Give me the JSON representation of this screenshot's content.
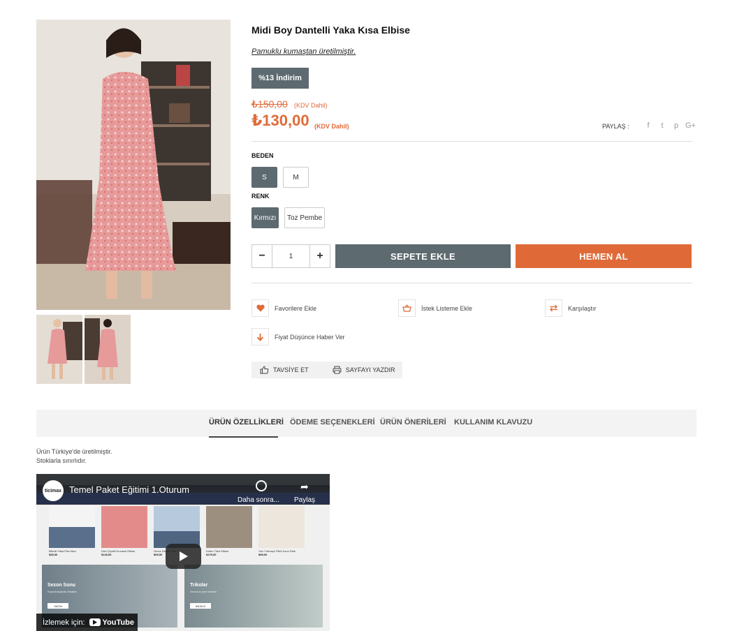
{
  "product": {
    "title": "Midi Boy Dantelli Yaka Kısa Elbise",
    "subtitle": "Pamuklu kumaştan üretilmiştir.",
    "discount_badge": "%13 İndirim",
    "old_price": "₺150,00",
    "old_price_kdv": "(KDV Dahil)",
    "new_price": "₺130,00",
    "new_price_kdv": "(KDV Dahil)"
  },
  "share": {
    "label": "PAYLAŞ :",
    "icons": [
      "facebook-icon",
      "twitter-icon",
      "pinterest-icon",
      "google-plus-icon"
    ],
    "glyphs": [
      "f",
      "t",
      "p",
      "G+"
    ]
  },
  "size": {
    "label": "BEDEN",
    "options": [
      "S",
      "M"
    ],
    "selected": "S"
  },
  "color": {
    "label": "RENK",
    "options": [
      "Kırmızı",
      "Toz Pembe"
    ],
    "selected": "Kırmızı"
  },
  "quantity": {
    "minus": "−",
    "value": "1",
    "plus": "+"
  },
  "buttons": {
    "add_to_cart": "SEPETE EKLE",
    "buy_now": "HEMEN AL"
  },
  "actions": {
    "favorites": "Favorilere Ekle",
    "wishlist": "İstek Listeme Ekle",
    "compare": "Karşılaştır",
    "price_alert": "Fiyat Düşünce Haber Ver"
  },
  "share_bar": {
    "recommend": "TAVSİYE ET",
    "print": "SAYFAYI YAZDIR"
  },
  "tabs": [
    {
      "label": "ÜRÜN ÖZELLİKLERİ",
      "active": true
    },
    {
      "label": "ÖDEME SEÇENEKLERİ",
      "active": false
    },
    {
      "label": "ÜRÜN ÖNERİLERİ",
      "active": false
    },
    {
      "label": "KULLANIM KLAVUZU",
      "active": false
    }
  ],
  "description": {
    "line1": "Ürün Türkiye'de üretilmiştir.",
    "line2": "Stoklarla sınırlıdır."
  },
  "video": {
    "channel_logo": "ticimax",
    "title": "Temel Paket Eğitimi 1.Oturum",
    "watch_later": "Daha sonra...",
    "share": "Paylaş",
    "watch_on": "İzlemek için:",
    "youtube": "YouTube",
    "products": [
      {
        "name": "Bikinili Yaka Pleo Bluz",
        "price": "$39,00"
      },
      {
        "name": "Dört Çiçekli Kruvaze Elbise",
        "price": "$129,00"
      },
      {
        "name": "Omuz Detaylı Bluz",
        "price": "$99,00"
      },
      {
        "name": "Keten Triko Elbise",
        "price": "$179,00"
      },
      {
        "name": "Yarı Yırtmaçlı Pileli Uzun Etek",
        "price": "$99,00"
      }
    ],
    "banners": [
      {
        "title": "Sezon Sonu",
        "subtitle": "Kaçırılmayacak fırsatlar",
        "button": "SATIN"
      },
      {
        "title": "Trikolar",
        "subtitle": "Sezonun yeni trikoları",
        "button": "İNCELE"
      }
    ]
  }
}
